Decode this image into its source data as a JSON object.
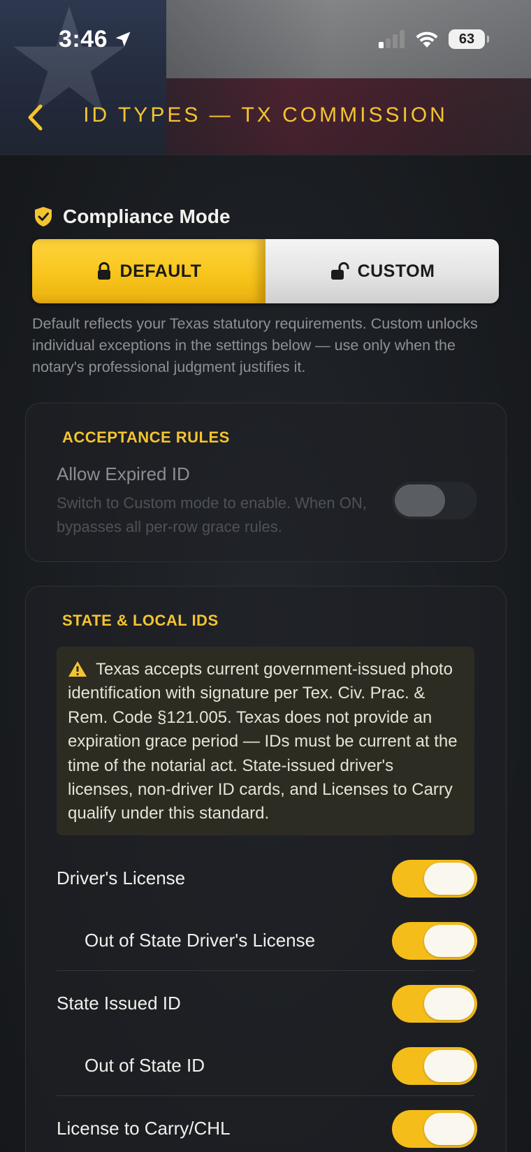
{
  "status_bar": {
    "time": "3:46",
    "battery": "63"
  },
  "nav": {
    "title": "ID TYPES — TX COMMISSION"
  },
  "compliance": {
    "title": "Compliance Mode",
    "options": [
      {
        "label": "DEFAULT",
        "selected": true
      },
      {
        "label": "CUSTOM",
        "selected": false
      }
    ],
    "description": "Default reflects your Texas statutory requirements. Custom unlocks individual exceptions in the settings below — use only when the notary's professional judgment justifies it."
  },
  "acceptance_rules": {
    "label": "ACCEPTANCE RULES",
    "allow_expired": {
      "title": "Allow Expired ID",
      "subtitle": "Switch to Custom mode to enable. When ON, bypasses all per-row grace rules.",
      "on": false
    }
  },
  "state_local": {
    "label": "STATE & LOCAL IDS",
    "notice": "Texas accepts current government-issued photo identification with signature per Tex. Civ. Prac. & Rem. Code §121.005. Texas does not provide an expiration grace period — IDs must be current at the time of the notarial act. State-issued driver's licenses, non-driver ID cards, and Licenses to Carry qualify under this standard.",
    "rows": [
      {
        "label": "Driver's License",
        "on": true
      },
      {
        "label": "Out of State Driver's License",
        "on": true
      },
      {
        "label": "State Issued ID",
        "on": true
      },
      {
        "label": "Out of State ID",
        "on": true
      },
      {
        "label": "License to Carry/CHL",
        "on": true
      }
    ]
  },
  "colors": {
    "accent": "#F4C430",
    "background": "#16191D",
    "toggle_on": "#F5BD1A"
  }
}
